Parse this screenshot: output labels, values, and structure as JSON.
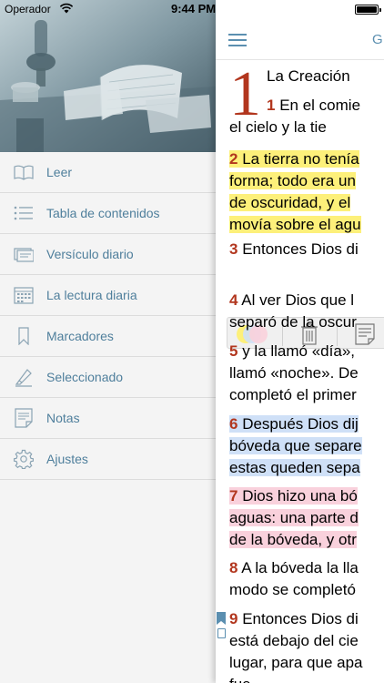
{
  "status_bar": {
    "carrier": "Operador",
    "time": "9:44 PM"
  },
  "menu": {
    "items": [
      {
        "label": "Leer",
        "icon": "book-open-icon"
      },
      {
        "label": "Tabla de contenidos",
        "icon": "list-icon"
      },
      {
        "label": "Versículo diario",
        "icon": "card-icon"
      },
      {
        "label": "La lectura diaria",
        "icon": "calendar-icon"
      },
      {
        "label": "Marcadores",
        "icon": "bookmark-icon"
      },
      {
        "label": "Seleccionado",
        "icon": "highlighter-icon"
      },
      {
        "label": "Notas",
        "icon": "notes-icon"
      },
      {
        "label": "Ajustes",
        "icon": "gear-icon"
      }
    ]
  },
  "reader": {
    "title": "G",
    "chapter_number": "1",
    "chapter_title": "La Creación",
    "verses": [
      {
        "n": "1",
        "lines": [
          "En el comie",
          "el cielo y la tie"
        ]
      },
      {
        "n": "2",
        "lines": [
          "La tierra no tenía",
          "forma; todo era un",
          "de oscuridad, y el",
          "movía sobre el agu"
        ],
        "highlight": "yellow"
      },
      {
        "n": "3",
        "lines": [
          "Entonces Dios di"
        ]
      },
      {
        "n": "4",
        "lines": [
          "Al ver Dios que l",
          "separó de la oscur"
        ]
      },
      {
        "n": "5",
        "lines": [
          "y la llamó «día»,",
          "llamó «noche». De",
          "completó el primer"
        ]
      },
      {
        "n": "6",
        "lines": [
          "Después Dios dij",
          "bóveda que separe",
          "estas queden sepa"
        ],
        "highlight": "blue"
      },
      {
        "n": "7",
        "lines": [
          "Dios hizo una bó",
          "aguas: una parte d",
          "de la bóveda, y otr"
        ],
        "highlight": "pink"
      },
      {
        "n": "8",
        "lines": [
          "A la bóveda la lla",
          "modo se completó"
        ]
      },
      {
        "n": "9",
        "lines": [
          "Entonces Dios di",
          "está debajo del cie",
          "lugar, para que apa",
          "fue."
        ]
      }
    ]
  },
  "colors": {
    "accent": "#5b8fb0",
    "verse_number": "#b2361e",
    "highlight_yellow": "#fdf07a",
    "highlight_blue": "#cfe0f7",
    "highlight_pink": "#f9d1dc"
  }
}
